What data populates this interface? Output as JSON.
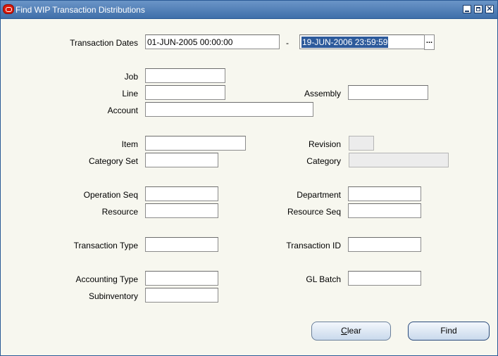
{
  "window": {
    "title": "Find  WIP Transaction Distributions"
  },
  "form": {
    "transaction_dates": {
      "label": "Transaction Dates",
      "from": "01-JUN-2005 00:00:00",
      "separator": "-",
      "to": "19-JUN-2006 23:59:59"
    },
    "job": {
      "label": "Job",
      "value": ""
    },
    "line": {
      "label": "Line",
      "value": ""
    },
    "assembly": {
      "label": "Assembly",
      "value": ""
    },
    "account": {
      "label": "Account",
      "value": ""
    },
    "item": {
      "label": "Item",
      "value": ""
    },
    "revision": {
      "label": "Revision",
      "value": ""
    },
    "category_set": {
      "label": "Category Set",
      "value": ""
    },
    "category": {
      "label": "Category",
      "value": ""
    },
    "operation_seq": {
      "label": "Operation Seq",
      "value": ""
    },
    "department": {
      "label": "Department",
      "value": ""
    },
    "resource": {
      "label": "Resource",
      "value": ""
    },
    "resource_seq": {
      "label": "Resource Seq",
      "value": ""
    },
    "transaction_type": {
      "label": "Transaction Type",
      "value": ""
    },
    "transaction_id": {
      "label": "Transaction ID",
      "value": ""
    },
    "accounting_type": {
      "label": "Accounting Type",
      "value": ""
    },
    "gl_batch": {
      "label": "GL Batch",
      "value": ""
    },
    "subinventory": {
      "label": "Subinventory",
      "value": ""
    }
  },
  "buttons": {
    "clear_prefix": "",
    "clear_mnemonic": "C",
    "clear_suffix": "lear",
    "find": "Find",
    "lov": "..."
  },
  "icons": {
    "app": "oracle-icon",
    "minimize": "minimize-icon",
    "maximize": "maximize-icon",
    "close": "close-icon"
  }
}
